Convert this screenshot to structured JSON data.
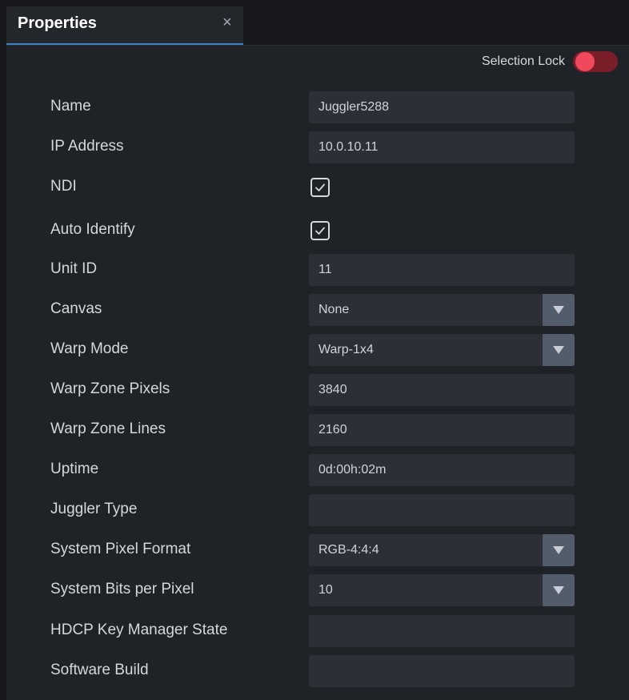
{
  "tab": {
    "title": "Properties",
    "close_glyph": "×"
  },
  "selection_lock": {
    "label": "Selection Lock",
    "state": "off",
    "color": "#f0485c"
  },
  "rows": {
    "name": {
      "label": "Name",
      "value": "Juggler5288"
    },
    "ip": {
      "label": "IP Address",
      "value": "10.0.10.11"
    },
    "ndi": {
      "label": "NDI",
      "checked": true
    },
    "auto_identify": {
      "label": "Auto Identify",
      "checked": true
    },
    "unit_id": {
      "label": "Unit ID",
      "value": "11"
    },
    "canvas": {
      "label": "Canvas",
      "value": "None"
    },
    "warp_mode": {
      "label": "Warp Mode",
      "value": "Warp-1x4"
    },
    "warp_zone_pixels": {
      "label": "Warp Zone Pixels",
      "value": "3840"
    },
    "warp_zone_lines": {
      "label": "Warp Zone Lines",
      "value": "2160"
    },
    "uptime": {
      "label": "Uptime",
      "value": "0d:00h:02m"
    },
    "juggler_type": {
      "label": "Juggler Type",
      "value": ""
    },
    "pixel_format": {
      "label": "System Pixel Format",
      "value": "RGB-4:4:4"
    },
    "bits_per_pixel": {
      "label": "System Bits per Pixel",
      "value": "10"
    },
    "hdcp_state": {
      "label": "HDCP Key Manager State",
      "value": ""
    },
    "software_build": {
      "label": "Software Build",
      "value": ""
    }
  }
}
